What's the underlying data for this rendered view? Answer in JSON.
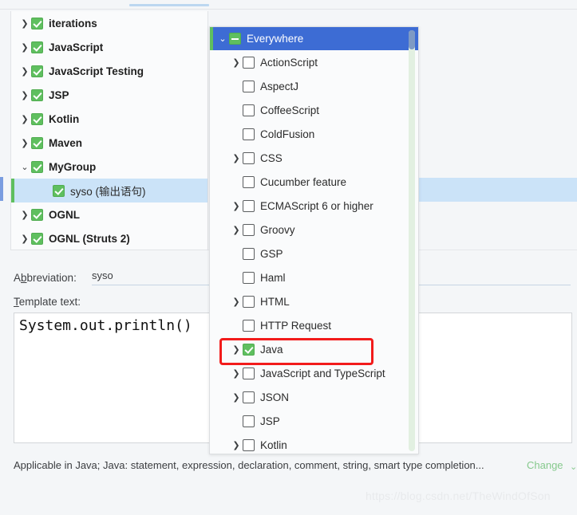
{
  "window": {
    "background_color": "#f4f6f8",
    "accent_blue": "#3d6cd4",
    "accent_green": "#5fbf5f",
    "selection_blue": "#cbe3f8",
    "annotation_red": "#f21b1b"
  },
  "tree": {
    "items": [
      {
        "label": "iterations",
        "indent": 0,
        "arrow": "collapsed",
        "checkbox": "checked",
        "selected": false
      },
      {
        "label": "JavaScript",
        "indent": 0,
        "arrow": "collapsed",
        "checkbox": "checked",
        "selected": false
      },
      {
        "label": "JavaScript Testing",
        "indent": 0,
        "arrow": "collapsed",
        "checkbox": "checked",
        "selected": false
      },
      {
        "label": "JSP",
        "indent": 0,
        "arrow": "collapsed",
        "checkbox": "checked",
        "selected": false
      },
      {
        "label": "Kotlin",
        "indent": 0,
        "arrow": "collapsed",
        "checkbox": "checked",
        "selected": false
      },
      {
        "label": "Maven",
        "indent": 0,
        "arrow": "collapsed",
        "checkbox": "checked",
        "selected": false
      },
      {
        "label": "MyGroup",
        "indent": 0,
        "arrow": "expanded",
        "checkbox": "checked",
        "selected": false
      },
      {
        "label": "syso (输出语句)",
        "indent": 1,
        "arrow": "none",
        "checkbox": "checked",
        "selected": true
      },
      {
        "label": "OGNL",
        "indent": 0,
        "arrow": "collapsed",
        "checkbox": "checked",
        "selected": false
      },
      {
        "label": "OGNL (Struts 2)",
        "indent": 0,
        "arrow": "collapsed",
        "checkbox": "checked",
        "selected": false
      }
    ]
  },
  "form": {
    "abbreviation_label_pre": "A",
    "abbreviation_label_mnemonic": "b",
    "abbreviation_label_post": "breviation:",
    "abbreviation_value": "syso",
    "abbreviation_placeholder": "",
    "template_label_mnemonic": "T",
    "template_label_post": "emplate text:",
    "template_text": "System.out.println()"
  },
  "status": {
    "text": "Applicable in Java; Java: statement, expression, declaration, comment, string, smart type completion...",
    "change_label": "Change",
    "change_chevron": "⌄",
    "change_color": "#86c98d"
  },
  "watermark": {
    "text": "https://blog.csdn.net/TheWindOfSon"
  },
  "popup": {
    "rows": [
      {
        "label": "Everywhere",
        "depth": 0,
        "arrow": "expanded",
        "checkbox": "indeterminate",
        "header": true,
        "annotated": false
      },
      {
        "label": "ActionScript",
        "depth": 1,
        "arrow": "collapsed",
        "checkbox": "unchecked",
        "header": false,
        "annotated": false
      },
      {
        "label": "AspectJ",
        "depth": 1,
        "arrow": "none",
        "checkbox": "unchecked",
        "header": false,
        "annotated": false
      },
      {
        "label": "CoffeeScript",
        "depth": 1,
        "arrow": "none",
        "checkbox": "unchecked",
        "header": false,
        "annotated": false
      },
      {
        "label": "ColdFusion",
        "depth": 1,
        "arrow": "none",
        "checkbox": "unchecked",
        "header": false,
        "annotated": false
      },
      {
        "label": "CSS",
        "depth": 1,
        "arrow": "collapsed",
        "checkbox": "unchecked",
        "header": false,
        "annotated": false
      },
      {
        "label": "Cucumber feature",
        "depth": 1,
        "arrow": "none",
        "checkbox": "unchecked",
        "header": false,
        "annotated": false
      },
      {
        "label": "ECMAScript 6 or higher",
        "depth": 1,
        "arrow": "collapsed",
        "checkbox": "unchecked",
        "header": false,
        "annotated": false
      },
      {
        "label": "Groovy",
        "depth": 1,
        "arrow": "collapsed",
        "checkbox": "unchecked",
        "header": false,
        "annotated": false
      },
      {
        "label": "GSP",
        "depth": 1,
        "arrow": "none",
        "checkbox": "unchecked",
        "header": false,
        "annotated": false
      },
      {
        "label": "Haml",
        "depth": 1,
        "arrow": "none",
        "checkbox": "unchecked",
        "header": false,
        "annotated": false
      },
      {
        "label": "HTML",
        "depth": 1,
        "arrow": "collapsed",
        "checkbox": "unchecked",
        "header": false,
        "annotated": false
      },
      {
        "label": "HTTP Request",
        "depth": 1,
        "arrow": "none",
        "checkbox": "unchecked",
        "header": false,
        "annotated": false
      },
      {
        "label": "Java",
        "depth": 1,
        "arrow": "collapsed",
        "checkbox": "checked",
        "header": false,
        "annotated": true
      },
      {
        "label": "JavaScript and TypeScript",
        "depth": 1,
        "arrow": "collapsed",
        "checkbox": "unchecked",
        "header": false,
        "annotated": false
      },
      {
        "label": "JSON",
        "depth": 1,
        "arrow": "collapsed",
        "checkbox": "unchecked",
        "header": false,
        "annotated": false
      },
      {
        "label": "JSP",
        "depth": 1,
        "arrow": "none",
        "checkbox": "unchecked",
        "header": false,
        "annotated": false
      },
      {
        "label": "Kotlin",
        "depth": 1,
        "arrow": "collapsed",
        "checkbox": "unchecked",
        "header": false,
        "annotated": false
      }
    ]
  },
  "icons": {
    "arrow_collapsed": "❯",
    "arrow_expanded": "⌄"
  }
}
